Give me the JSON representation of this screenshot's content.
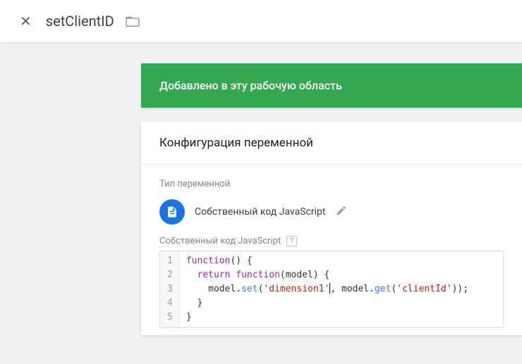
{
  "header": {
    "close_glyph": "✕",
    "title": "setClientID"
  },
  "banner": {
    "text": "Добавлено в эту рабочую область"
  },
  "panel": {
    "title": "Конфигурация переменной",
    "type_section_label": "Тип переменной",
    "type_name": "Собственный код JavaScript",
    "code_section_label": "Собственный код JavaScript",
    "help_glyph": "?",
    "code": {
      "lines": [
        "1",
        "2",
        "3",
        "4",
        "5"
      ],
      "l1_kw": "function",
      "l1_rest": "() {",
      "l2_kw": "return",
      "l2_fn": " function",
      "l2_rest": "(model) {",
      "l3_indent": "    model.",
      "l3_set": "set",
      "l3_p1": "(",
      "l3_s1": "'dimension1'",
      "l3_c1": ",",
      "l3_space": " model.",
      "l3_get": "get",
      "l3_p2": "(",
      "l3_s2": "'clientId'",
      "l3_end": "));",
      "l4": "  }",
      "l5": "}"
    }
  }
}
